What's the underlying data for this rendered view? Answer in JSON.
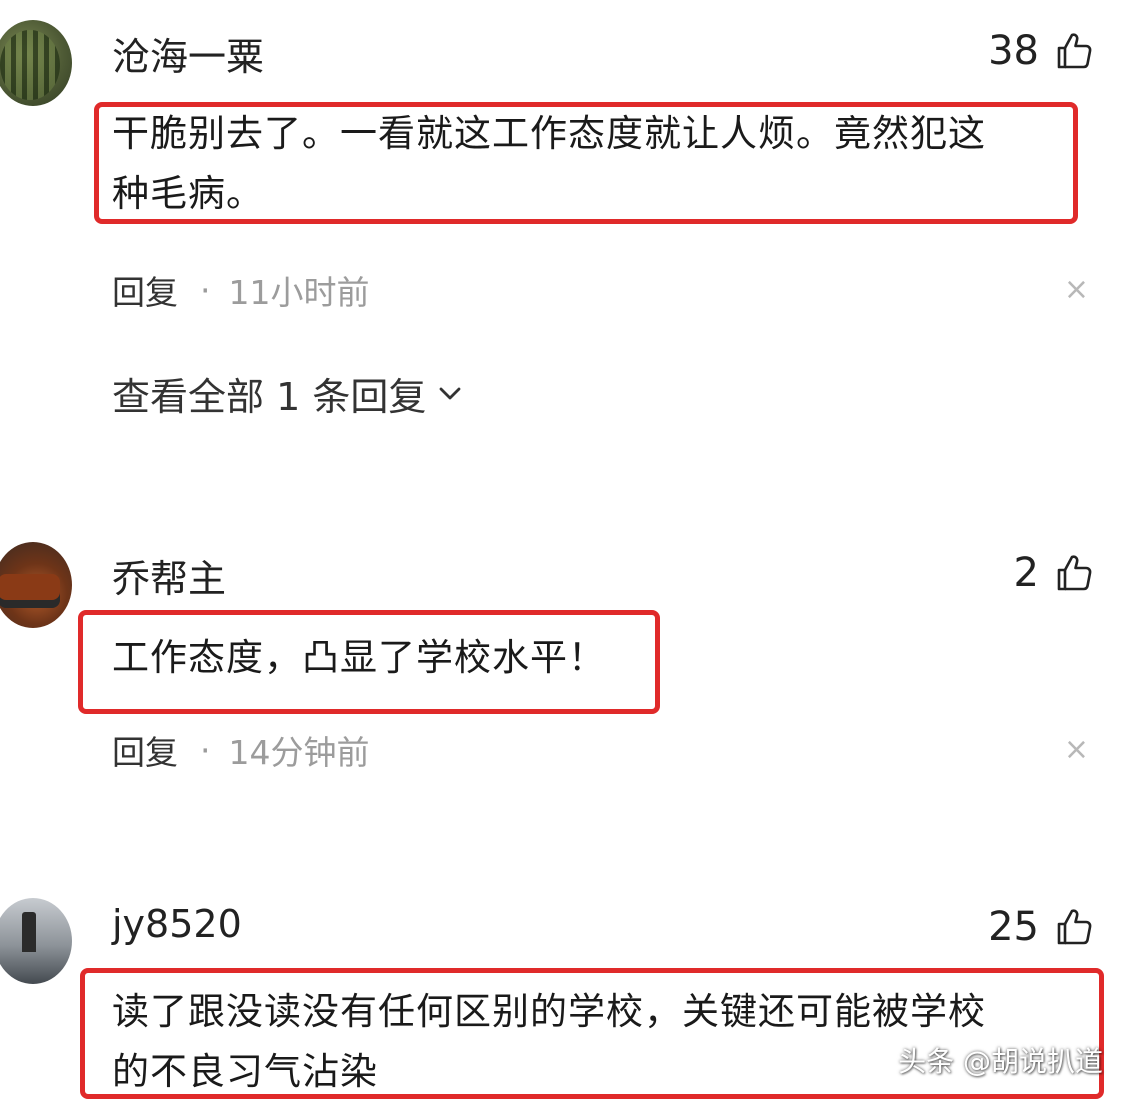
{
  "comments": [
    {
      "username": "沧海一粟",
      "likes": "38",
      "text_lines": [
        "干脆别去了。一看就这工作态度就让人烦。竟然犯这",
        "种毛病。"
      ],
      "reply_label": "回复",
      "separator": "·",
      "time": "11小时前",
      "view_replies": "查看全部 1 条回复"
    },
    {
      "username": "乔帮主",
      "likes": "2",
      "text_lines": [
        "工作态度，凸显了学校水平！"
      ],
      "reply_label": "回复",
      "separator": "·",
      "time": "14分钟前"
    },
    {
      "username": "jy8520",
      "likes": "25",
      "text_lines": [
        "读了跟没读没有任何区别的学校，关键还可能被学校",
        "的不良习气沾染"
      ]
    }
  ],
  "close_glyph": "×",
  "watermark": "头条 @胡说扒道",
  "colors": {
    "highlight": "#e02a2a",
    "meta_gray": "#9c9c9c"
  },
  "icons": {
    "like": "thumbs-up-icon",
    "close": "close-icon",
    "expand": "chevron-down-icon"
  }
}
